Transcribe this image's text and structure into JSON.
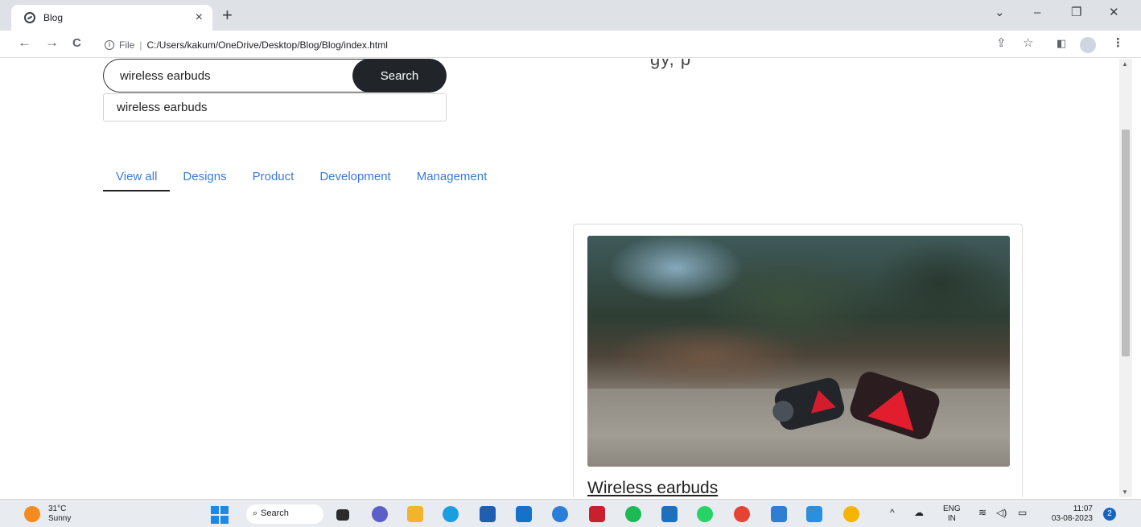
{
  "browser": {
    "tab_title": "Blog",
    "tab_close": "×",
    "new_tab": "+",
    "window_controls": {
      "dropdown": "⌄",
      "minimize": "–",
      "restore": "❐",
      "close": "✕"
    },
    "nav": {
      "back": "←",
      "forward": "→",
      "reload": "C"
    },
    "address": {
      "scheme_label": "File",
      "separator": "|",
      "url": "C:/Users/kakum/OneDrive/Desktop/Blog/Blog/index.html"
    },
    "icons": [
      "share-icon",
      "star-icon",
      "sidepanel-icon",
      "profile-icon",
      "menu-icon"
    ]
  },
  "page": {
    "cut_text": "gy,            p",
    "search": {
      "value": "wireless earbuds",
      "button_label": "Search"
    },
    "suggestion": "wireless earbuds",
    "tabs": [
      {
        "label": "View all",
        "active": true
      },
      {
        "label": "Designs",
        "active": false
      },
      {
        "label": "Product",
        "active": false
      },
      {
        "label": "Development",
        "active": false
      },
      {
        "label": "Management",
        "active": false
      }
    ],
    "card": {
      "title": "Wireless earbuds"
    }
  },
  "taskbar": {
    "weather": {
      "temp": "31°C",
      "condition": "Sunny"
    },
    "search_label": "Search",
    "language": {
      "lang": "ENG",
      "region": "IN"
    },
    "clock": {
      "time": "11:07",
      "date": "03-08-2023"
    },
    "notifications": "2",
    "colors": {
      "accent": "#1e88e5",
      "dark_button": "#212529",
      "link": "#3a7bd5"
    }
  }
}
